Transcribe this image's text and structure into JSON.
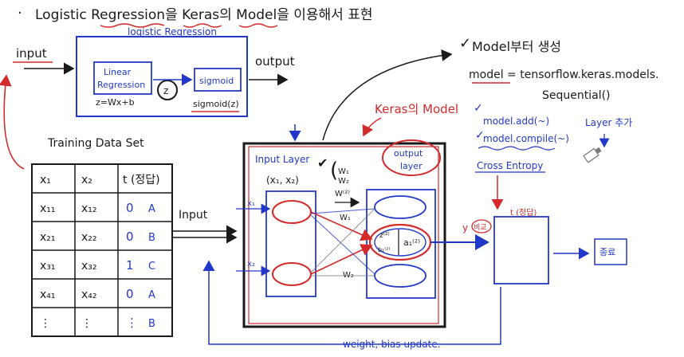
{
  "title": "Logistic Regression을 Keras의 Model을 이용해서 표현",
  "bullet": "·",
  "top_diagram": {
    "box_title": "logistic Regression",
    "input": "input",
    "output": "output",
    "linear_line1": "Linear",
    "linear_line2": "Regression",
    "z_circle": "z",
    "sigmoid": "sigmoid",
    "z_formula": "z=Wx+b",
    "sigmoid_formula": "sigmoid(z)"
  },
  "model_notes": {
    "model_creation": "Model부터 생성",
    "code_line1": "model = tensorflow.keras.models.",
    "code_line2": "Sequential()",
    "keras_model": "Keras의 Model",
    "add_line": "model.add(~)",
    "add_note": "Layer 추가",
    "compile_line": "model.compile(~)",
    "cross_entropy": "Cross Entropy"
  },
  "training": {
    "title": "Training Data Set",
    "headers": [
      "x₁",
      "x₂",
      "t (정답)"
    ],
    "rows": [
      [
        "x₁₁",
        "x₁₂",
        "0",
        "A"
      ],
      [
        "x₂₁",
        "x₂₂",
        "0",
        "B"
      ],
      [
        "x₃₁",
        "x₃₂",
        "1",
        "C"
      ],
      [
        "x₄₁",
        "x₄₂",
        "0",
        "A"
      ],
      [
        "⋮",
        "⋮",
        "⋮",
        "B"
      ]
    ]
  },
  "network": {
    "input_label": "Input",
    "input_layer": "Input Layer",
    "input_vars": "(x₁, x₂)",
    "output_layer_line1": "output",
    "output_layer_line2": "layer",
    "weights": [
      "W₁",
      "W₂",
      "W⁽²⁾"
    ],
    "w1": "W₁",
    "w2": "W₂",
    "x1": "x₁",
    "x2": "x₂",
    "z2": "z⁽²⁾",
    "a1": "a₁⁽²⁾",
    "b1": "b₁⁽²⁾",
    "y": "y",
    "compare": "비교",
    "target": "t (정답)",
    "finish": "종료",
    "update": "weight, bias update."
  },
  "colors": {
    "ink_black": "#1a1a1a",
    "ink_blue": "#2238c8",
    "ink_red": "#d42a2a",
    "paper": "#ffffff",
    "gray": "#7a7a7a"
  }
}
